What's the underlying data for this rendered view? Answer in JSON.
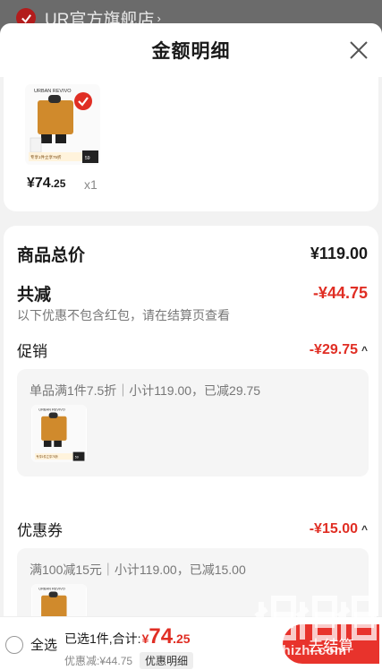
{
  "store": {
    "name": "UR官方旗舰店",
    "chevron": "›"
  },
  "sheet": {
    "title": "金额明细",
    "close_icon": "close-icon"
  },
  "product": {
    "brand": "URBAN REVIVO",
    "price_int": "¥74",
    "price_dec": ".25",
    "qty": "x1",
    "tag_main": "专享1件立享75折",
    "tag_side": "59",
    "shirt_color": "#d08a2c"
  },
  "summary": {
    "total_label": "商品总价",
    "total_value": "¥119.00",
    "reduce_label": "共减",
    "reduce_value": "-¥44.75",
    "reduce_note": "以下优惠不包含红包，请在结算页查看"
  },
  "promo": {
    "label": "促销",
    "value": "-¥29.75",
    "detail": "单品满1件7.5折｜小计119.00，已减29.75"
  },
  "coupon": {
    "label": "优惠券",
    "value": "-¥15.00",
    "detail": "满100减15元｜小计119.00，已减15.00"
  },
  "caret": "^",
  "bottom": {
    "select_all": "全选",
    "selected_text": "已选1件,合计:",
    "total_yen": "¥",
    "total_int": "74",
    "total_dec": ".25",
    "discount_text": "优惠减:¥44.75",
    "detail_button": "优惠明细",
    "checkout_label": "去结算"
  },
  "watermark": {
    "text": "zhizhizhi.com"
  },
  "colors": {
    "accent": "#e02e24",
    "checkout": "#e8332c"
  }
}
